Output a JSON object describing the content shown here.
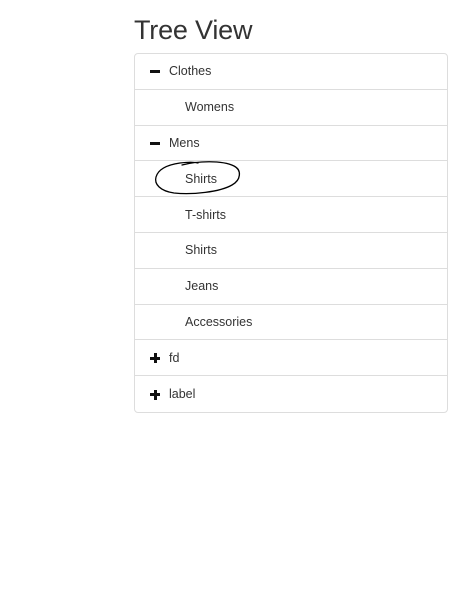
{
  "page": {
    "title": "Tree View"
  },
  "tree": {
    "nodes": [
      {
        "label": "Clothes",
        "toggle": "minus-icon",
        "expanded": true,
        "level": 0
      },
      {
        "label": "Womens",
        "toggle": null,
        "level": 1
      },
      {
        "label": "Mens",
        "toggle": "minus-icon",
        "expanded": true,
        "level": 0
      },
      {
        "label": "Shirts",
        "toggle": null,
        "level": 1,
        "circled": true
      },
      {
        "label": "T-shirts",
        "toggle": null,
        "level": 1
      },
      {
        "label": "Shirts",
        "toggle": null,
        "level": 1
      },
      {
        "label": "Jeans",
        "toggle": null,
        "level": 1
      },
      {
        "label": "Accessories",
        "toggle": null,
        "level": 1
      },
      {
        "label": "fd",
        "toggle": "plus-icon",
        "expanded": false,
        "level": 0
      },
      {
        "label": "label",
        "toggle": "plus-icon",
        "expanded": false,
        "level": 0
      }
    ]
  },
  "colors": {
    "text": "#333333",
    "border": "#dddddd",
    "toggle": "#111111",
    "annotation": "#000000"
  }
}
